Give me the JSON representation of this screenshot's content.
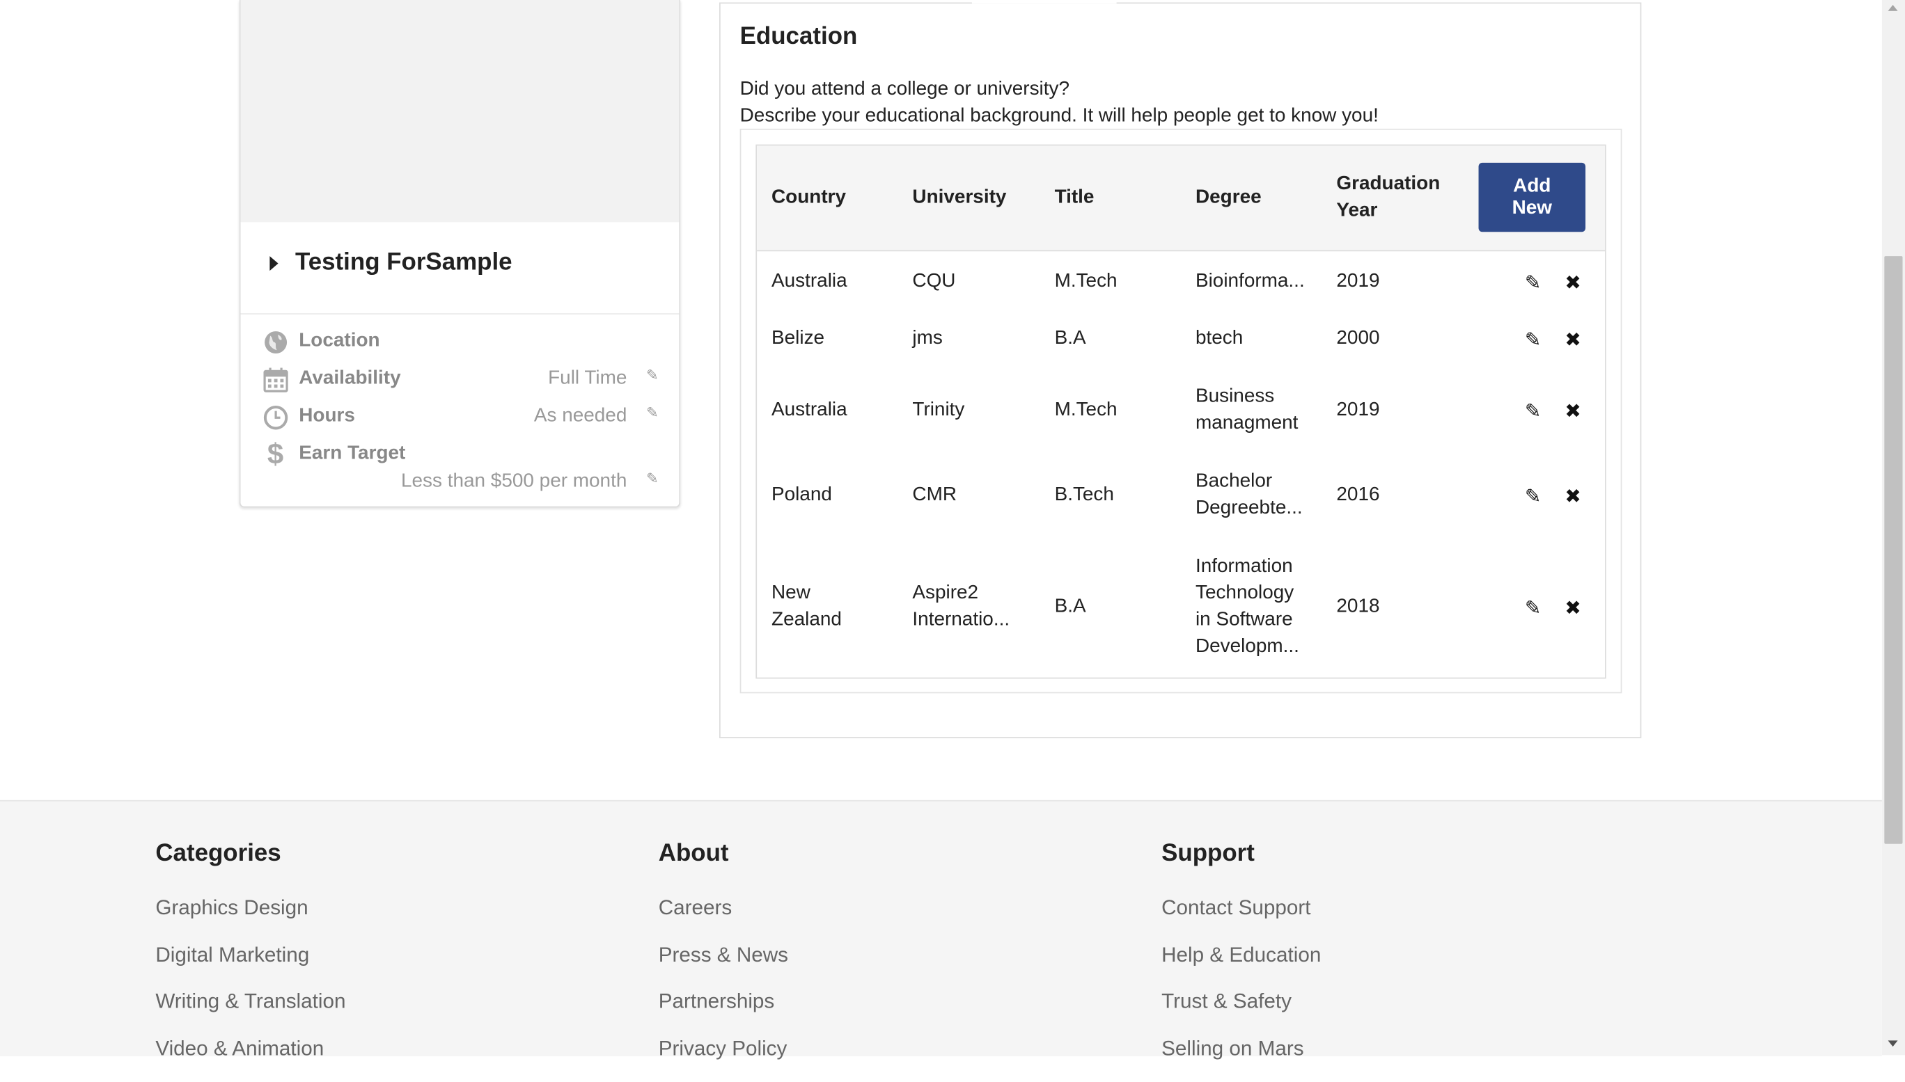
{
  "profile": {
    "name": "Testing ForSample",
    "location_label": "Location",
    "availability_label": "Availability",
    "availability_value": "Full Time",
    "hours_label": "Hours",
    "hours_value": "As needed",
    "earn_label": "Earn Target",
    "earn_value": "Less than $500 per month"
  },
  "education": {
    "title": "Education",
    "intro_line1": "Did you attend a college or university?",
    "intro_line2": "Describe your educational background. It will help people get to know you!",
    "headers": {
      "country": "Country",
      "university": "University",
      "title": "Title",
      "degree": "Degree",
      "grad_line1": "Graduation",
      "grad_line2": "Year"
    },
    "add_line1": "Add",
    "add_line2": "New",
    "rows": [
      {
        "country": "Australia",
        "university": "CQU",
        "title": "M.Tech",
        "degree": "Bioinforma...",
        "year": "2019"
      },
      {
        "country": "Belize",
        "university": "jms",
        "title": "B.A",
        "degree": "btech",
        "year": "2000"
      },
      {
        "country": "Australia",
        "university": "Trinity",
        "title": "M.Tech",
        "degree": "Business managment",
        "year": "2019"
      },
      {
        "country": "Poland",
        "university": "CMR",
        "title": "B.Tech",
        "degree": "Bachelor Degreebte...",
        "year": "2016"
      },
      {
        "country": "New Zealand",
        "university": "Aspire2 Internatio...",
        "title": "B.A",
        "degree": "Information Technology in Software Developm...",
        "year": "2018"
      }
    ],
    "edit_icon": "pencil-icon",
    "delete_icon": "close-icon"
  },
  "footer": {
    "categories": {
      "title": "Categories",
      "links": [
        "Graphics Design",
        "Digital Marketing",
        "Writing & Translation",
        "Video & Animation"
      ]
    },
    "about": {
      "title": "About",
      "links": [
        "Careers",
        "Press & News",
        "Partnerships",
        "Privacy Policy"
      ]
    },
    "support": {
      "title": "Support",
      "links": [
        "Contact Support",
        "Help & Education",
        "Trust & Safety",
        "Selling on Mars"
      ]
    }
  },
  "colors": {
    "accent": "#2f4a8a",
    "footer_bg": "#f5f5f5",
    "muted_text": "#888888"
  }
}
